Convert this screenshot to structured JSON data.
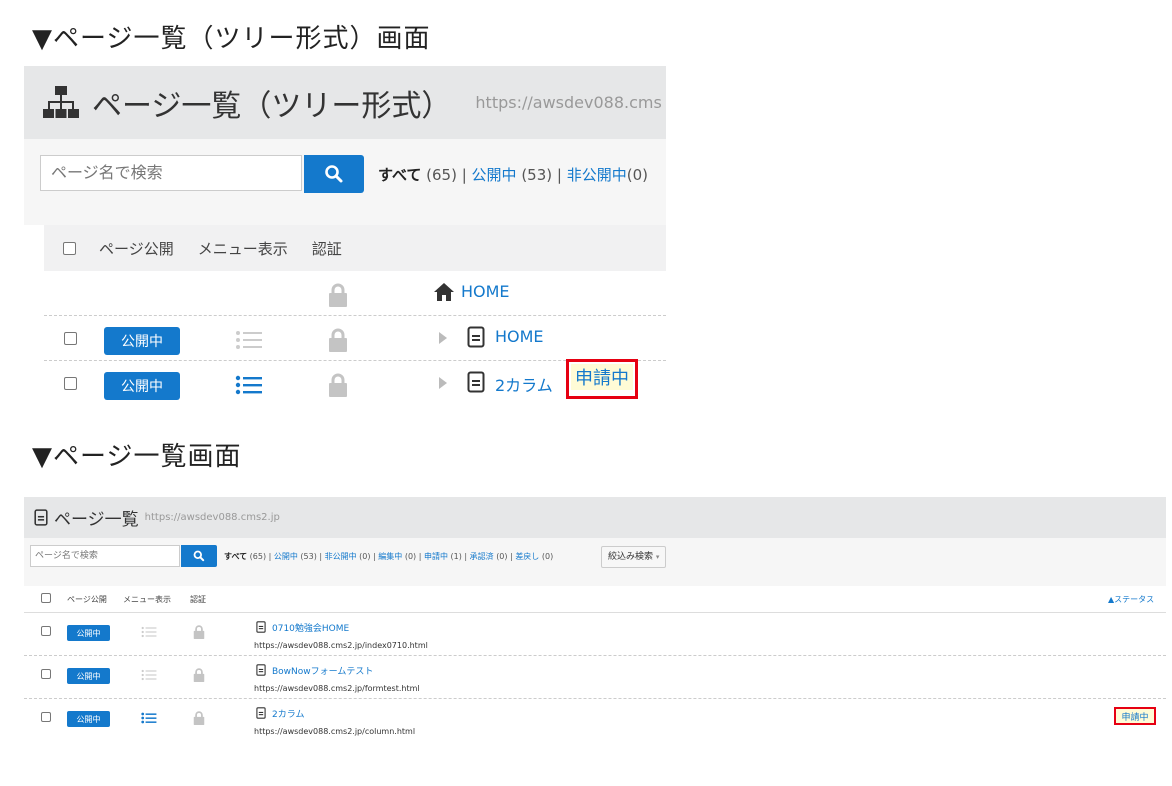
{
  "headings": {
    "tree": "▼ページ一覧（ツリー形式）画面",
    "list": "▼ページ一覧画面"
  },
  "tree_view": {
    "title": "ページ一覧（ツリー形式）",
    "url": "https://awsdev088.cms",
    "search_placeholder": "ページ名で検索",
    "filters": {
      "all": "すべて",
      "all_count": "(65)",
      "published": "公開中",
      "published_count": "(53)",
      "unpublished": "非公開中",
      "unpublished_count": "(0)"
    },
    "columns": {
      "publish": "ページ公開",
      "menu": "メニュー表示",
      "auth": "認証"
    },
    "home_label": "HOME",
    "rows": [
      {
        "publish": "公開中",
        "title": "HOME"
      },
      {
        "publish": "公開中",
        "title": "2カラム",
        "status": "申請中"
      }
    ]
  },
  "list_view": {
    "title": "ページ一覧",
    "url": "https://awsdev088.cms2.jp",
    "search_placeholder": "ページ名で検索",
    "filters": {
      "all": "すべて",
      "all_count": "(65)",
      "published": "公開中",
      "published_count": "(53)",
      "unpublished": "非公開中",
      "unpublished_count": "(0)",
      "editing": "編集中",
      "editing_count": "(0)",
      "applying": "申請中",
      "applying_count": "(1)",
      "approved": "承認済",
      "approved_count": "(0)",
      "sentback": "差戻し",
      "sentback_count": "(0)"
    },
    "narrow_button": "絞込み検索",
    "columns": {
      "publish": "ページ公開",
      "menu": "メニュー表示",
      "auth": "認証",
      "status": "▲ステータス"
    },
    "rows": [
      {
        "publish": "公開中",
        "title": "0710勉強会HOME",
        "url": "https://awsdev088.cms2.jp/index0710.html"
      },
      {
        "publish": "公開中",
        "title": "BowNowフォームテスト",
        "url": "https://awsdev088.cms2.jp/formtest.html"
      },
      {
        "publish": "公開中",
        "title": "2カラム",
        "url": "https://awsdev088.cms2.jp/column.html",
        "status": "申請中"
      }
    ]
  },
  "colors": {
    "accent": "#1479cc",
    "highlight_border": "#e60012",
    "header_bg": "#e6e7e8"
  },
  "icons": [
    "sitemap-icon",
    "search-icon",
    "home-icon",
    "triangle-right-icon",
    "page-icon",
    "list-icon",
    "lock-icon",
    "chevron-down-icon"
  ]
}
